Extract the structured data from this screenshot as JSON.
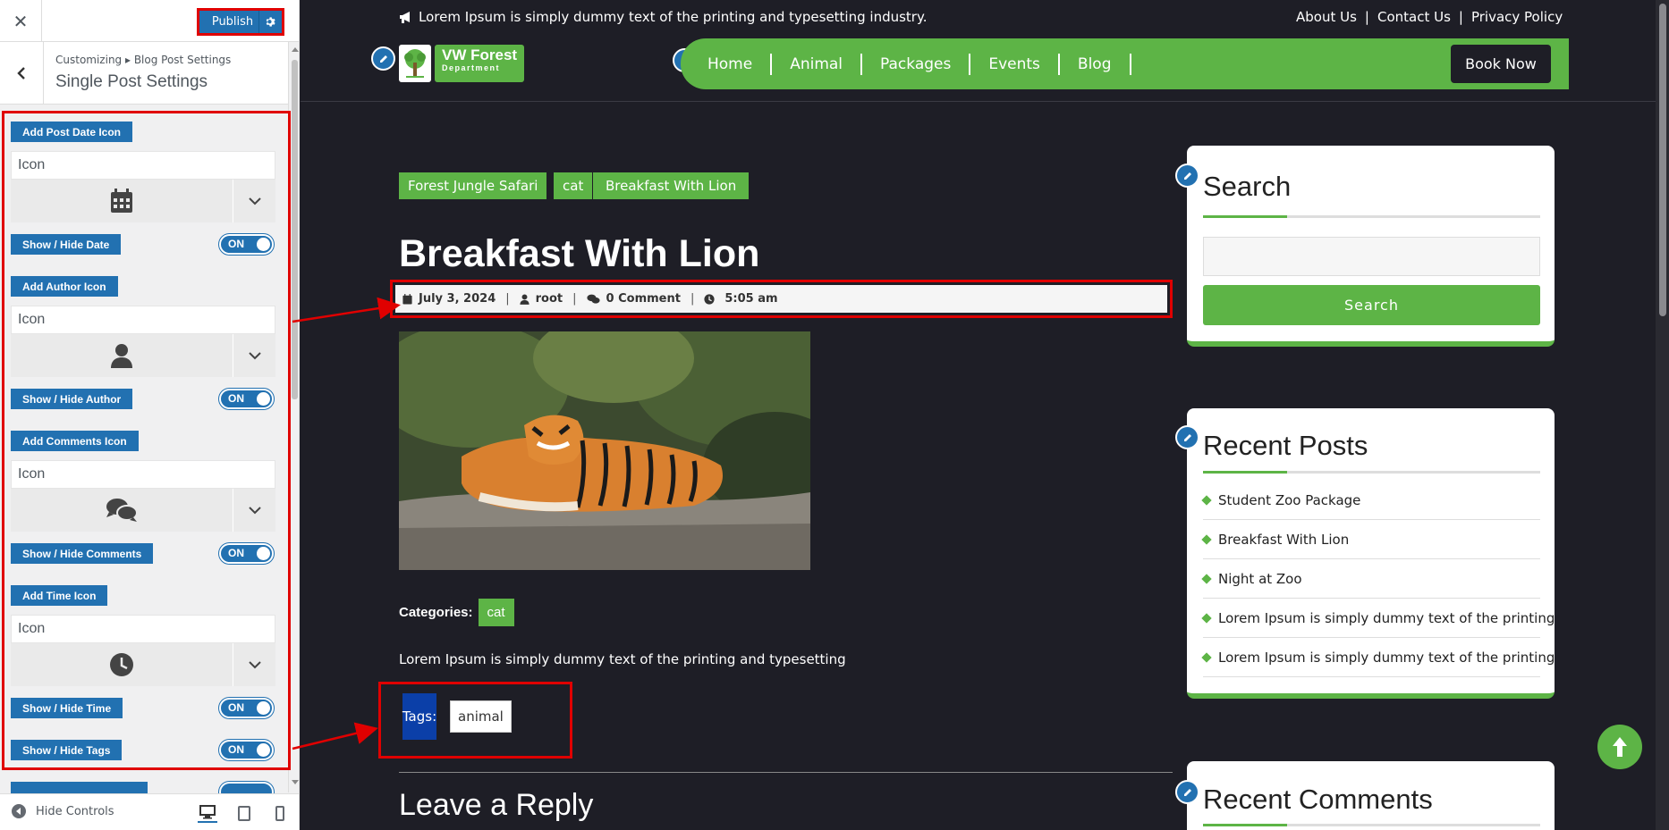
{
  "customizer": {
    "close_glyph": "✕",
    "publish_label": "Publish",
    "breadcrumb": "Customizing ▸ Blog Post Settings",
    "section_title": "Single Post Settings",
    "add_date_icon_label": "Add Post Date Icon",
    "date_icon_placeholder": "Icon",
    "show_hide_date_label": "Show / Hide Date",
    "date_toggle": "ON",
    "add_author_icon_label": "Add Author Icon",
    "author_icon_placeholder": "Icon",
    "show_hide_author_label": "Show / Hide Author",
    "author_toggle": "ON",
    "add_comments_icon_label": "Add Comments Icon",
    "comments_icon_placeholder": "Icon",
    "show_hide_comments_label": "Show / Hide Comments",
    "comments_toggle": "ON",
    "add_time_icon_label": "Add Time Icon",
    "time_icon_placeholder": "Icon",
    "show_hide_time_label": "Show / Hide Time",
    "time_toggle": "ON",
    "show_hide_tags_label": "Show / Hide Tags",
    "tags_toggle": "ON",
    "hide_controls_label": "Hide Controls",
    "icons": [
      "calendar-icon",
      "user-icon",
      "comments-icon",
      "clock-icon"
    ]
  },
  "site": {
    "announcement": "Lorem Ipsum is simply dummy text of the printing and typesetting industry.",
    "top_links": [
      "About Us",
      "Contact Us",
      "Privacy Policy"
    ],
    "top_sep": "|",
    "logo_name": "VW Forest",
    "logo_sub": "Department",
    "nav": [
      "Home",
      "Animal",
      "Packages",
      "Events",
      "Blog"
    ],
    "book_now": "Book Now",
    "accent_color": "#5db446"
  },
  "post": {
    "categories_top": [
      "Forest Jungle Safari",
      "cat",
      "Breakfast With Lion"
    ],
    "title": "Breakfast With Lion",
    "meta": {
      "date": "July 3, 2024",
      "author": "root",
      "comments": "0 Comment",
      "time": "5:05 am"
    },
    "meta_sep": "|",
    "categories_label": "Categories:",
    "category": "cat",
    "excerpt": "Lorem Ipsum is simply dummy text of the printing and typesetting",
    "tags_label": "Tags:",
    "tag": "animal",
    "leave_reply": "Leave a Reply"
  },
  "sidebar": {
    "search_title": "Search",
    "search_button": "Search",
    "recent_posts_title": "Recent Posts",
    "recent_posts": [
      "Student Zoo Package",
      "Breakfast With Lion",
      "Night at Zoo",
      "Lorem Ipsum is simply dummy text of the printing",
      "Lorem Ipsum is simply dummy text of the printing"
    ],
    "recent_comments_title": "Recent Comments"
  }
}
